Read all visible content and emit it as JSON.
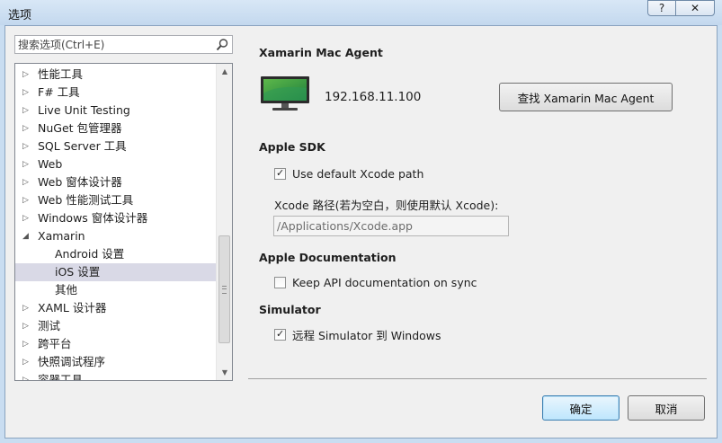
{
  "window": {
    "title": "选项",
    "help_label": "?",
    "close_label": "✕"
  },
  "search": {
    "placeholder": "搜索选项(Ctrl+E)"
  },
  "tree": {
    "items": [
      {
        "label": "性能工具",
        "expandable": true,
        "expanded": false
      },
      {
        "label": "F# 工具",
        "expandable": true,
        "expanded": false
      },
      {
        "label": "Live Unit Testing",
        "expandable": true,
        "expanded": false
      },
      {
        "label": "NuGet 包管理器",
        "expandable": true,
        "expanded": false
      },
      {
        "label": "SQL Server 工具",
        "expandable": true,
        "expanded": false
      },
      {
        "label": "Web",
        "expandable": true,
        "expanded": false
      },
      {
        "label": "Web 窗体设计器",
        "expandable": true,
        "expanded": false
      },
      {
        "label": "Web 性能测试工具",
        "expandable": true,
        "expanded": false
      },
      {
        "label": "Windows 窗体设计器",
        "expandable": true,
        "expanded": false
      },
      {
        "label": "Xamarin",
        "expandable": true,
        "expanded": true
      },
      {
        "label": "Android 设置",
        "child": true
      },
      {
        "label": "iOS 设置",
        "child": true,
        "selected": true
      },
      {
        "label": "其他",
        "child": true
      },
      {
        "label": "XAML 设计器",
        "expandable": true,
        "expanded": false
      },
      {
        "label": "测试",
        "expandable": true,
        "expanded": false
      },
      {
        "label": "跨平台",
        "expandable": true,
        "expanded": false
      },
      {
        "label": "快照调试程序",
        "expandable": true,
        "expanded": false
      },
      {
        "label": "容器工具",
        "expandable": true,
        "expanded": false
      }
    ]
  },
  "mac_agent": {
    "heading": "Xamarin Mac Agent",
    "ip": "192.168.11.100",
    "find_button": "查找 Xamarin Mac Agent"
  },
  "apple_sdk": {
    "heading": "Apple SDK",
    "use_default_label": "Use default Xcode path",
    "use_default_checked": true,
    "xcode_path_label": "Xcode 路径(若为空白，则使用默认 Xcode):",
    "xcode_path_value": "/Applications/Xcode.app"
  },
  "apple_docs": {
    "heading": "Apple Documentation",
    "keep_sync_label": "Keep API documentation on sync",
    "keep_sync_checked": false
  },
  "simulator": {
    "heading": "Simulator",
    "remote_label": "远程 Simulator 到 Windows",
    "remote_checked": true
  },
  "footer": {
    "ok_label": "确定",
    "cancel_label": "取消"
  },
  "colors": {
    "frame": "#c9ddf1",
    "panel": "#f0f0f0",
    "selection": "#d9d9e6",
    "accent_button": "#3c7fb1"
  }
}
